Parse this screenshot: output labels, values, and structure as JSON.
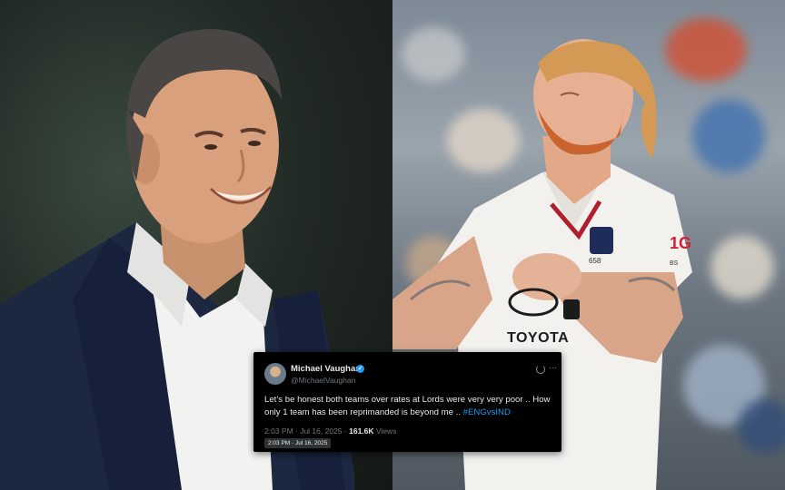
{
  "tweet": {
    "author_name": "Michael Vaughan",
    "author_handle": "@MichaelVaughan",
    "text": "Let’s be honest both teams over rates at Lords were very very poor .. How only 1 team has been reprimanded is beyond me ..",
    "hashtag": "#ENGvsIND",
    "timestamp": "2:03 PM · Jul 16, 2025",
    "separator": "·",
    "views_count": "161.6K",
    "views_label": "Views",
    "tooltip": "2:03 PM · Jul 16, 2025"
  },
  "shirt": {
    "sponsor": "TOYOTA",
    "number": "1G",
    "cap_number": "658",
    "suffix": "BS"
  },
  "colors": {
    "verified": "#1d9bf0",
    "hashtag": "#1d9bf0",
    "card_bg": "#000000"
  }
}
